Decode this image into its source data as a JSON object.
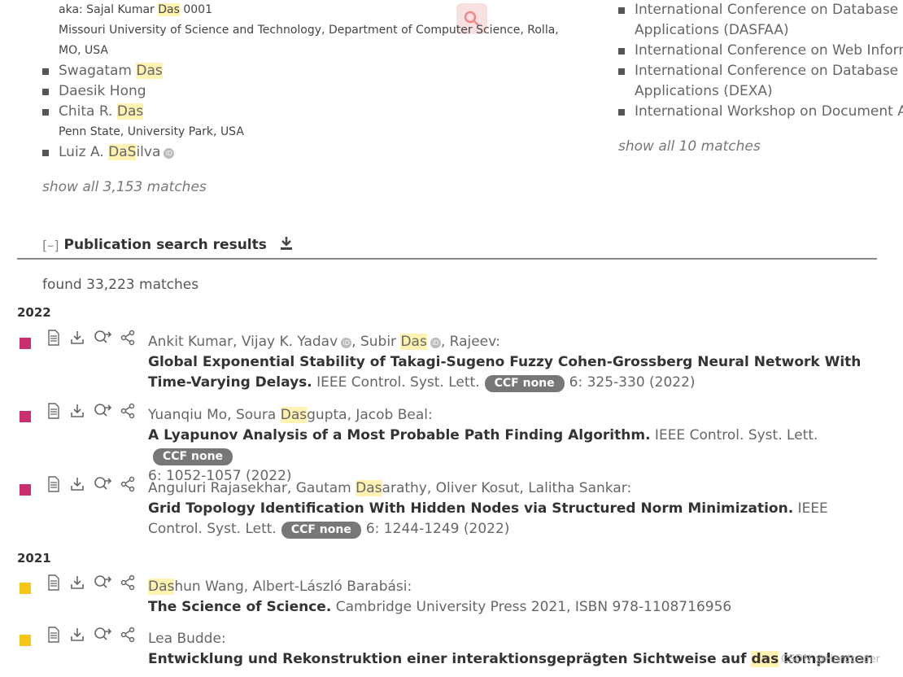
{
  "authors": {
    "items": [
      {
        "pre": "aka: Sajal Kumar ",
        "hl": "Das",
        "post": " 0001",
        "kind": "note"
      },
      {
        "pre": "Missouri University of Science and Technology, Department of Computer Science, Rolla,",
        "hl": "",
        "post": "",
        "kind": "note"
      },
      {
        "pre": "MO, USA",
        "hl": "",
        "post": "",
        "kind": "note"
      },
      {
        "pre": "Swagatam ",
        "hl": "Das",
        "post": "",
        "kind": "author"
      },
      {
        "pre": "Daesik Hong",
        "hl": "",
        "post": "",
        "kind": "author"
      },
      {
        "pre": "Chita R. ",
        "hl": "Das",
        "post": "",
        "kind": "author"
      },
      {
        "pre": "Penn State, University Park, USA",
        "hl": "",
        "post": "",
        "kind": "note"
      },
      {
        "pre": "Luiz A. ",
        "hl": "DaS",
        "post": "ilva",
        "kind": "author"
      }
    ],
    "show_all": "show all 3,153 matches"
  },
  "venues": {
    "items": [
      "International Conference on Database Systems for Advanced",
      "Applications (DASFAA)",
      "International Conference on Web Information Systems",
      "International Conference on Database and Expert Systems",
      "Applications (DEXA)",
      "International Workshop on Document Analysis Systems"
    ],
    "show_all": "show all 10 matches"
  },
  "publications": {
    "toggle": "[–]",
    "title": "Publication search results",
    "found": "found 33,223 matches",
    "years": [
      "2022",
      "2021"
    ],
    "ccf_label": "CCF none",
    "entries": [
      {
        "a1": "Ankit Kumar, Vijay K. Yadav",
        "a2": ", Subir ",
        "hl": "Das",
        "a3": ", Rajeev:",
        "title": "Global Exponential Stability of Takagi-Sugeno Fuzzy Cohen-Grossberg Neural Network With Time-Varying Delays.",
        "venue": " IEEE Control. Syst. Lett.",
        "pages": "6: 325-330 (2022)"
      },
      {
        "a1": "Yuanqiu Mo, Soura ",
        "hl": "Das",
        "a2": "gupta, Jacob Beal:",
        "title": "A Lyapunov Analysis of a Most Probable Path Finding Algorithm.",
        "venue": " IEEE Control. Syst. Lett.",
        "pages": "6: 1052-1057 (2022)"
      },
      {
        "a1": "Anguluri Rajasekhar, Gautam ",
        "hl": "Das",
        "a2": "arathy, Oliver Kosut, Lalitha Sankar:",
        "title": "Grid Topology Identification With Hidden Nodes via Structured Norm Minimization.",
        "venue": " IEEE Control. Syst. Lett.",
        "pages": "6: 1244-1249 (2022)"
      },
      {
        "hl": "Das",
        "a1": "hun Wang, Albert-László Barabási:",
        "title": "The Science of Science.",
        "venue": " Cambridge University Press 2021, ISBN 978-1108716956"
      },
      {
        "a1": "Lea Budde:",
        "t1": "Entwicklung und Rekonstruktion einer interaktionsgeprägten Sichtweise auf ",
        "hl": "das",
        "t2": " komplementäre"
      }
    ]
  },
  "watermark": "CSDN @Hardcoder",
  "colors": {
    "journal": "#c8306e",
    "book": "#f5c518",
    "highlight": "#fff2b3",
    "badge": "#777777"
  }
}
